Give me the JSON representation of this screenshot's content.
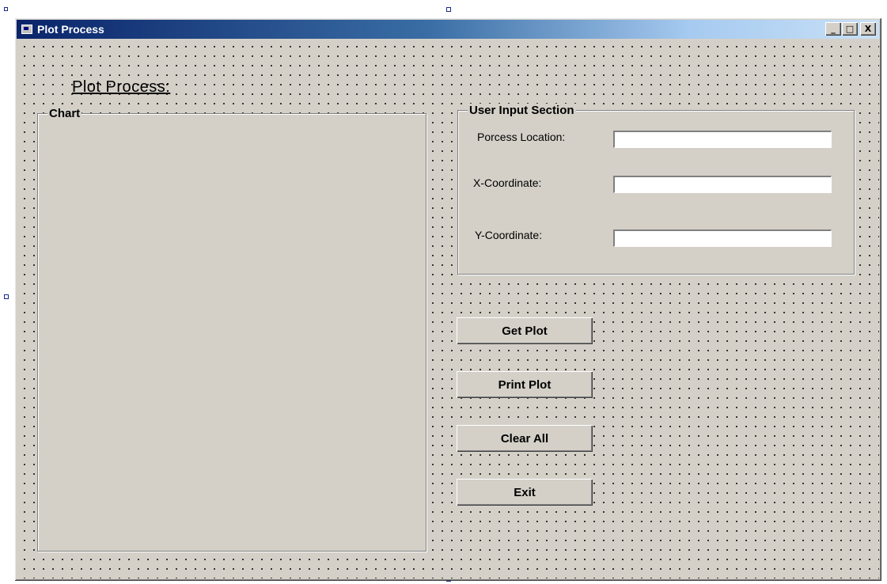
{
  "window": {
    "title": "Plot Process",
    "controls": {
      "minimize": "_",
      "maximize": "□",
      "close": "X"
    }
  },
  "form": {
    "heading": "Plot Process:",
    "chart_frame": {
      "label": "Chart"
    },
    "input_section": {
      "label": "User Input Section",
      "fields": [
        {
          "label": "Porcess Location:",
          "value": ""
        },
        {
          "label": "X-Coordinate:",
          "value": ""
        },
        {
          "label": "Y-Coordinate:",
          "value": ""
        }
      ]
    },
    "buttons": {
      "get_plot": "Get Plot",
      "print_plot": "Print Plot",
      "clear_all": "Clear All",
      "exit": "Exit"
    }
  },
  "icons": {
    "app": "form-icon"
  }
}
